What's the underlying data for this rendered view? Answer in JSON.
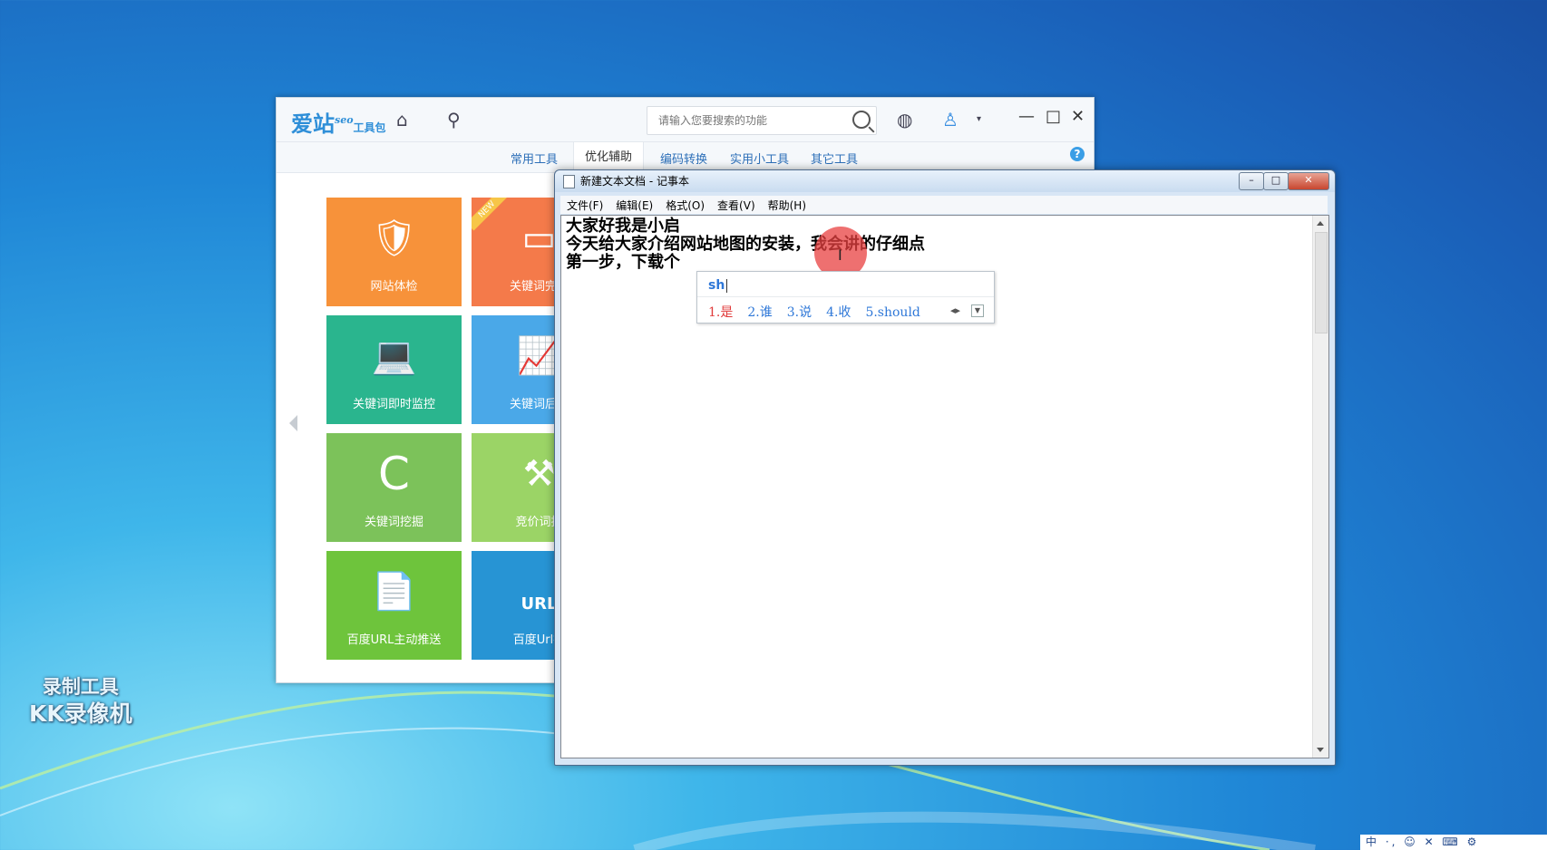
{
  "aizhan": {
    "logo_main": "爱站",
    "logo_seo": "seo",
    "logo_sub": "工具包",
    "search_placeholder": "请输入您要搜索的功能",
    "tabs": [
      "常用工具",
      "优化辅助",
      "编码转换",
      "实用小工具",
      "其它工具"
    ],
    "active_tab_index": 1,
    "help": "?",
    "tiles": [
      {
        "label": "网站体检",
        "color": "#f7923a",
        "icon": "shield-stethoscope-icon",
        "glyph": "🛡"
      },
      {
        "label": "关键词完成",
        "color": "#f47a4a",
        "icon": "monitor-chart-icon",
        "glyph": "▭",
        "badge": "NEW"
      },
      {
        "label": "关键词即时监控",
        "color": "#2ab58e",
        "icon": "laptop-wifi-icon",
        "glyph": "💻"
      },
      {
        "label": "关键词后台",
        "color": "#4aa8e8",
        "icon": "trend-chart-icon",
        "glyph": "📈"
      },
      {
        "label": "关键词挖掘",
        "color": "#7cc25a",
        "icon": "c-logo-icon",
        "glyph": "C"
      },
      {
        "label": "竞价词批",
        "color": "#9bd466",
        "icon": "gavel-icon",
        "glyph": "⚒"
      },
      {
        "label": "百度URL主动推送",
        "color": "#6ec43c",
        "icon": "file-arrow-icon",
        "glyph": "📄"
      },
      {
        "label": "百度Url提",
        "color": "#2794d4",
        "icon": "url-file-icon",
        "glyph": "URL"
      }
    ]
  },
  "notepad": {
    "title": "新建文本文档 - 记事本",
    "menu": [
      "文件(F)",
      "编辑(E)",
      "格式(O)",
      "查看(V)",
      "帮助(H)"
    ],
    "lines": [
      "大家好我是小启",
      "今天给大家介绍网站地图的安装，我会讲的仔细点",
      "第一步，下载个"
    ],
    "controls": {
      "minimize": "–",
      "maximize": "□",
      "close": "✕"
    }
  },
  "ime": {
    "composition": "sh",
    "candidates": [
      "1.是",
      "2.谁",
      "3.说",
      "4.收",
      "5.should"
    ]
  },
  "watermark": {
    "line1": "录制工具",
    "line2": "KK录像机"
  },
  "tray": {
    "text": "中 ·, ☺ ✕ ⌨ ⚙"
  }
}
